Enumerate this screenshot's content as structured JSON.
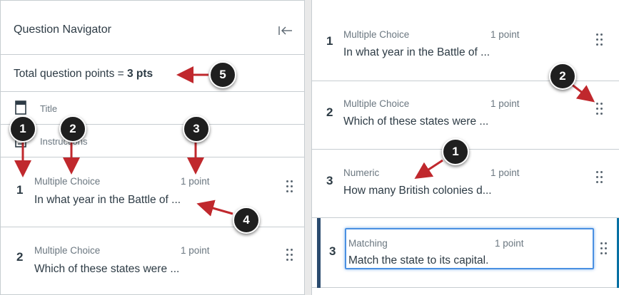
{
  "navigator": {
    "title": "Question Navigator",
    "collapse_icon": "collapse-left-icon",
    "total_label": "Total question points = ",
    "total_value": "3 pts",
    "title_row": "Title",
    "instructions_row": "Instructions",
    "questions": [
      {
        "number": "1",
        "type": "Multiple Choice",
        "points": "1 point",
        "text": "In what year in the Battle of ..."
      },
      {
        "number": "2",
        "type": "Multiple Choice",
        "points": "1 point",
        "text": "Which of these states were ..."
      }
    ]
  },
  "right_panel": {
    "questions": [
      {
        "number": "1",
        "type": "Multiple Choice",
        "points": "1 point",
        "text": "In what year in the Battle of ..."
      },
      {
        "number": "2",
        "type": "Multiple Choice",
        "points": "1 point",
        "text": "Which of these states were ..."
      },
      {
        "number": "3",
        "type": "Numeric",
        "points": "1 point",
        "text": "How many British colonies d..."
      },
      {
        "number": "3",
        "type": "Matching",
        "points": "1 point",
        "text": "Match the state to its capital."
      }
    ]
  },
  "callouts": {
    "left": [
      "1",
      "2",
      "3",
      "4",
      "5"
    ],
    "right": [
      "1",
      "2"
    ]
  },
  "colors": {
    "callout_bg": "#1f1f1f",
    "arrow": "#c0282d",
    "focus": "#4a90e2",
    "active_bar": "#2b4b6f"
  }
}
